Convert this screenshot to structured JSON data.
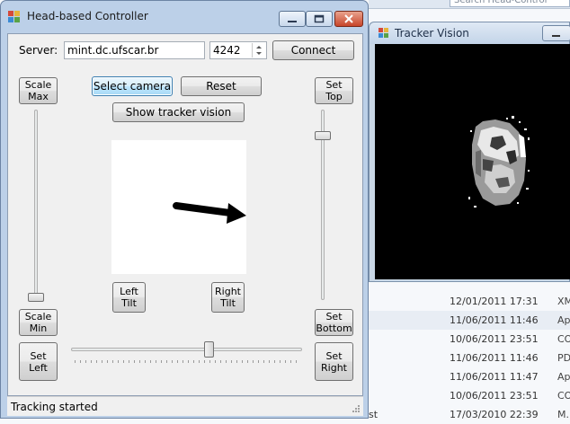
{
  "background": {
    "search_placeholder": "Search Head-Control",
    "stray_text": "st",
    "rows": [
      {
        "date": "12/01/2011 17:31",
        "type": "XM"
      },
      {
        "date": "11/06/2011 11:46",
        "type": "Ap"
      },
      {
        "date": "10/06/2011 23:51",
        "type": "CO"
      },
      {
        "date": "11/06/2011 11:46",
        "type": "PD"
      },
      {
        "date": "11/06/2011 11:47",
        "type": "Ap"
      },
      {
        "date": "10/06/2011 23:51",
        "type": "CO"
      },
      {
        "date": "17/03/2010 22:39",
        "type": "M..."
      }
    ]
  },
  "tracker_window": {
    "title": "Tracker Vision"
  },
  "window": {
    "title": "Head-based Controller"
  },
  "server": {
    "label": "Server:",
    "host": "mint.dc.ufscar.br",
    "port": "4242",
    "connect_label": "Connect"
  },
  "buttons": {
    "select_camera": "Select camera",
    "reset": "Reset",
    "show_tracker_vision": "Show tracker vision",
    "scale_max": [
      "Scale",
      "Max"
    ],
    "scale_min": [
      "Scale",
      "Min"
    ],
    "set_top": [
      "Set",
      "Top"
    ],
    "set_bottom": [
      "Set",
      "Bottom"
    ],
    "left_tilt": [
      "Left",
      "Tilt"
    ],
    "right_tilt": [
      "Right",
      "Tilt"
    ],
    "set_left": [
      "Set",
      "Left"
    ],
    "set_right": [
      "Set",
      "Right"
    ]
  },
  "sliders": {
    "scale_level": 0.0,
    "vertical_level": 0.85,
    "horizontal_level": 0.6
  },
  "status": {
    "text": "Tracking started"
  },
  "colors": {
    "arrow": "#000000",
    "preview_bg": "#ffffff",
    "vision_bg": "#000000"
  }
}
